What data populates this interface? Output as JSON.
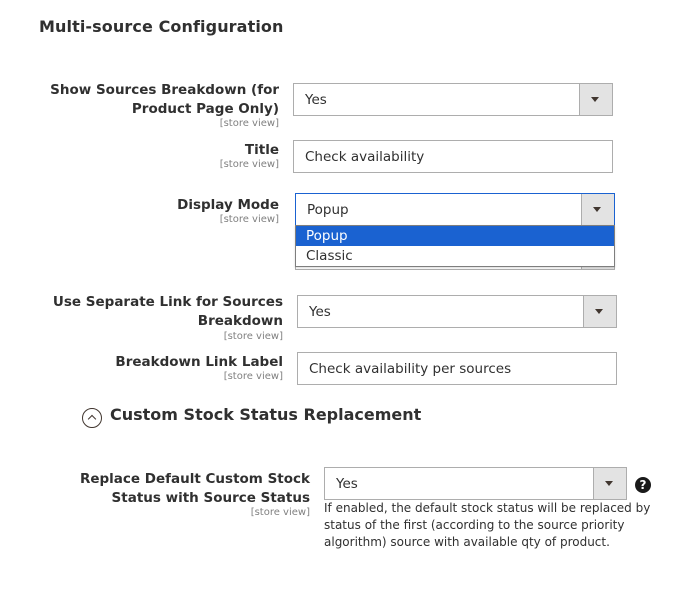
{
  "section_title": "Multi-source Configuration",
  "scope_label": "[store view]",
  "fields": {
    "show_sources_breakdown": {
      "label_line1": "Show Sources Breakdown (for",
      "label_line2": "Product Page Only)",
      "value": "Yes"
    },
    "title": {
      "label": "Title",
      "value": "Check availability"
    },
    "display_mode": {
      "label": "Display Mode",
      "value": "Popup",
      "options": [
        "Popup",
        "Classic"
      ],
      "selected_option": "Popup"
    },
    "use_separate_link": {
      "label_line1": "Use Separate Link for Sources",
      "label_line2": "Breakdown",
      "value": "Yes"
    },
    "breakdown_link_label": {
      "label": "Breakdown Link Label",
      "value": "Check availability per sources"
    }
  },
  "custom_stock_section": {
    "title": "Custom Stock Status Replacement",
    "replace_default": {
      "label_line1": "Replace Default Custom Stock",
      "label_line2": "Status with Source Status",
      "value": "Yes",
      "help_glyph": "?",
      "note_line1": "If enabled, the default stock status will be replaced by",
      "note_line2": "status of the first (according to the source priority",
      "note_line3": "algorithm) source with available qty of product."
    }
  },
  "colors": {
    "selected_option_bg": "#1a62d1",
    "border": "#adadad",
    "select_button_bg": "#e3e3e3"
  }
}
